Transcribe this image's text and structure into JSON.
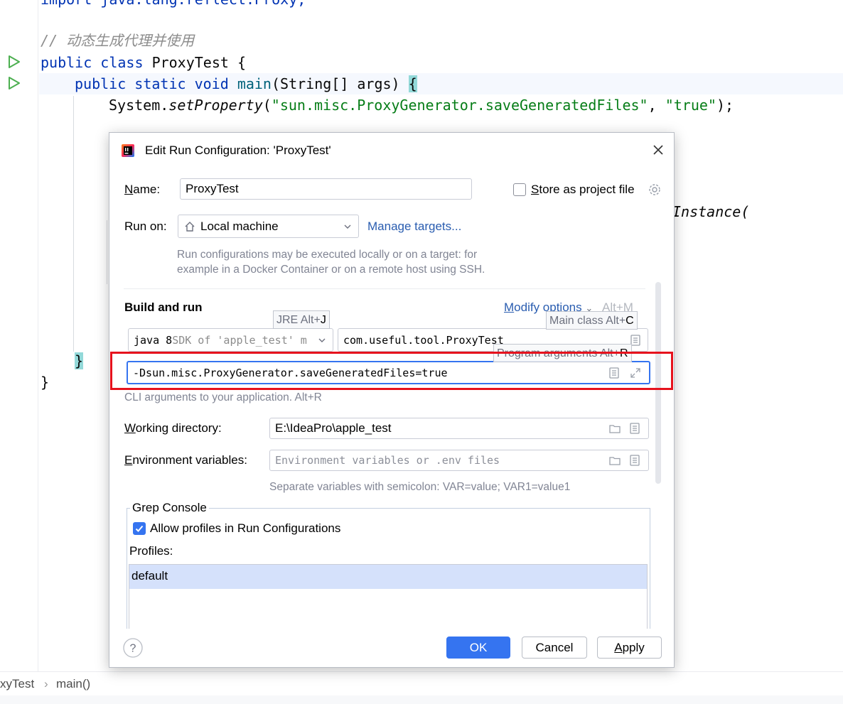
{
  "editor": {
    "line_import": "import java.lang.reflect.Proxy;",
    "comment": "// 动态生成代理并使用",
    "class_decl": {
      "kw1": "public",
      "kw2": "class",
      "name": "ProxyTest",
      "brace": "{"
    },
    "main_decl": {
      "kw1": "public",
      "kw2": "static",
      "kw3": "void",
      "name": "main",
      "params": "(String[] args) ",
      "brace": "{"
    },
    "set_property": {
      "obj": "System.",
      "method": "setProperty",
      "open": "(",
      "arg1": "\"sun.misc.ProxyGenerator.saveGeneratedFiles\"",
      "comma": ", ",
      "arg2": "\"true\"",
      "close": ");"
    },
    "partial_instance": "Instance(",
    "close_brace_inner": "}",
    "close_brace_outer": "}"
  },
  "breadcrumb": {
    "class": "xyTest",
    "sep": "›",
    "method": "main()"
  },
  "dialog": {
    "title": "Edit Run Configuration: 'ProxyTest'",
    "name_label_u": "N",
    "name_label_rest": "ame:",
    "name_value": "ProxyTest",
    "store_label_u": "S",
    "store_label_rest": "tore as project file",
    "store_checked": false,
    "run_on_label": "Run on:",
    "run_on_value": "Local machine",
    "manage_targets": "Manage targets...",
    "run_on_hint_line1": "Run configurations may be executed locally or on a target: for",
    "run_on_hint_line2": "example in a Docker Container or on a remote host using SSH.",
    "build_and_run": "Build and run",
    "modify_options_u": "M",
    "modify_options_rest": "odify options",
    "modify_options_shortcut": "Alt+M",
    "jre_tooltip": "JRE Alt+",
    "jre_tooltip_key": "J",
    "jre_value_main": "java 8",
    "jre_value_sdk": " SDK of 'apple_test' m",
    "main_class_tooltip": "Main class Alt+",
    "main_class_tooltip_key": "C",
    "main_class_value": "com.useful.tool.ProxyTest",
    "program_args_tooltip": "Program arguments Alt+",
    "program_args_tooltip_key": "R",
    "vm_options_value": "-Dsun.misc.ProxyGenerator.saveGeneratedFiles=true",
    "cli_hint": "CLI arguments to your application. Alt+R",
    "working_dir_label_u": "W",
    "working_dir_label_rest": "orking directory:",
    "working_dir_value": "E:\\IdeaPro\\apple_test",
    "env_label_u": "E",
    "env_label_rest": "nvironment variables:",
    "env_placeholder": "Environment variables or .env files",
    "env_hint": "Separate variables with semicolon: VAR=value; VAR1=value1",
    "grep_console_title": "Grep Console",
    "allow_profiles_label": "Allow profiles in Run Configurations",
    "allow_profiles_checked": true,
    "profiles_label": "Profiles:",
    "profiles": [
      "default"
    ],
    "help": "?",
    "ok": "OK",
    "cancel": "Cancel",
    "apply_u": "A",
    "apply_rest": "pply"
  },
  "colors": {
    "accent": "#3574f0",
    "highlight_box": "#e6121d",
    "keyword": "#0033b3",
    "string": "#067d17",
    "run_icon": "#4caf50"
  },
  "icons": [
    "run-icon",
    "intellij-logo-icon",
    "close-icon",
    "gear-icon",
    "home-icon",
    "chevron-down-icon",
    "document-icon",
    "expand-icon",
    "folder-icon",
    "help-icon",
    "checkmark-icon"
  ]
}
